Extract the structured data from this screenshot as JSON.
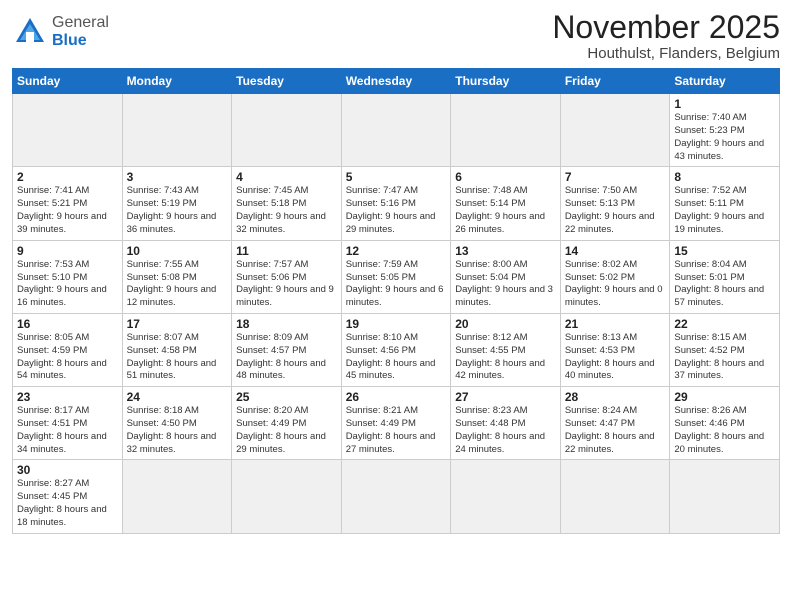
{
  "header": {
    "logo_general": "General",
    "logo_blue": "Blue",
    "month_year": "November 2025",
    "location": "Houthulst, Flanders, Belgium"
  },
  "weekdays": [
    "Sunday",
    "Monday",
    "Tuesday",
    "Wednesday",
    "Thursday",
    "Friday",
    "Saturday"
  ],
  "weeks": [
    [
      {
        "day": "",
        "info": ""
      },
      {
        "day": "",
        "info": ""
      },
      {
        "day": "",
        "info": ""
      },
      {
        "day": "",
        "info": ""
      },
      {
        "day": "",
        "info": ""
      },
      {
        "day": "",
        "info": ""
      },
      {
        "day": "1",
        "info": "Sunrise: 7:40 AM\nSunset: 5:23 PM\nDaylight: 9 hours\nand 43 minutes."
      }
    ],
    [
      {
        "day": "2",
        "info": "Sunrise: 7:41 AM\nSunset: 5:21 PM\nDaylight: 9 hours\nand 39 minutes."
      },
      {
        "day": "3",
        "info": "Sunrise: 7:43 AM\nSunset: 5:19 PM\nDaylight: 9 hours\nand 36 minutes."
      },
      {
        "day": "4",
        "info": "Sunrise: 7:45 AM\nSunset: 5:18 PM\nDaylight: 9 hours\nand 32 minutes."
      },
      {
        "day": "5",
        "info": "Sunrise: 7:47 AM\nSunset: 5:16 PM\nDaylight: 9 hours\nand 29 minutes."
      },
      {
        "day": "6",
        "info": "Sunrise: 7:48 AM\nSunset: 5:14 PM\nDaylight: 9 hours\nand 26 minutes."
      },
      {
        "day": "7",
        "info": "Sunrise: 7:50 AM\nSunset: 5:13 PM\nDaylight: 9 hours\nand 22 minutes."
      },
      {
        "day": "8",
        "info": "Sunrise: 7:52 AM\nSunset: 5:11 PM\nDaylight: 9 hours\nand 19 minutes."
      }
    ],
    [
      {
        "day": "9",
        "info": "Sunrise: 7:53 AM\nSunset: 5:10 PM\nDaylight: 9 hours\nand 16 minutes."
      },
      {
        "day": "10",
        "info": "Sunrise: 7:55 AM\nSunset: 5:08 PM\nDaylight: 9 hours\nand 12 minutes."
      },
      {
        "day": "11",
        "info": "Sunrise: 7:57 AM\nSunset: 5:06 PM\nDaylight: 9 hours\nand 9 minutes."
      },
      {
        "day": "12",
        "info": "Sunrise: 7:59 AM\nSunset: 5:05 PM\nDaylight: 9 hours\nand 6 minutes."
      },
      {
        "day": "13",
        "info": "Sunrise: 8:00 AM\nSunset: 5:04 PM\nDaylight: 9 hours\nand 3 minutes."
      },
      {
        "day": "14",
        "info": "Sunrise: 8:02 AM\nSunset: 5:02 PM\nDaylight: 9 hours\nand 0 minutes."
      },
      {
        "day": "15",
        "info": "Sunrise: 8:04 AM\nSunset: 5:01 PM\nDaylight: 8 hours\nand 57 minutes."
      }
    ],
    [
      {
        "day": "16",
        "info": "Sunrise: 8:05 AM\nSunset: 4:59 PM\nDaylight: 8 hours\nand 54 minutes."
      },
      {
        "day": "17",
        "info": "Sunrise: 8:07 AM\nSunset: 4:58 PM\nDaylight: 8 hours\nand 51 minutes."
      },
      {
        "day": "18",
        "info": "Sunrise: 8:09 AM\nSunset: 4:57 PM\nDaylight: 8 hours\nand 48 minutes."
      },
      {
        "day": "19",
        "info": "Sunrise: 8:10 AM\nSunset: 4:56 PM\nDaylight: 8 hours\nand 45 minutes."
      },
      {
        "day": "20",
        "info": "Sunrise: 8:12 AM\nSunset: 4:55 PM\nDaylight: 8 hours\nand 42 minutes."
      },
      {
        "day": "21",
        "info": "Sunrise: 8:13 AM\nSunset: 4:53 PM\nDaylight: 8 hours\nand 40 minutes."
      },
      {
        "day": "22",
        "info": "Sunrise: 8:15 AM\nSunset: 4:52 PM\nDaylight: 8 hours\nand 37 minutes."
      }
    ],
    [
      {
        "day": "23",
        "info": "Sunrise: 8:17 AM\nSunset: 4:51 PM\nDaylight: 8 hours\nand 34 minutes."
      },
      {
        "day": "24",
        "info": "Sunrise: 8:18 AM\nSunset: 4:50 PM\nDaylight: 8 hours\nand 32 minutes."
      },
      {
        "day": "25",
        "info": "Sunrise: 8:20 AM\nSunset: 4:49 PM\nDaylight: 8 hours\nand 29 minutes."
      },
      {
        "day": "26",
        "info": "Sunrise: 8:21 AM\nSunset: 4:49 PM\nDaylight: 8 hours\nand 27 minutes."
      },
      {
        "day": "27",
        "info": "Sunrise: 8:23 AM\nSunset: 4:48 PM\nDaylight: 8 hours\nand 24 minutes."
      },
      {
        "day": "28",
        "info": "Sunrise: 8:24 AM\nSunset: 4:47 PM\nDaylight: 8 hours\nand 22 minutes."
      },
      {
        "day": "29",
        "info": "Sunrise: 8:26 AM\nSunset: 4:46 PM\nDaylight: 8 hours\nand 20 minutes."
      }
    ],
    [
      {
        "day": "30",
        "info": "Sunrise: 8:27 AM\nSunset: 4:45 PM\nDaylight: 8 hours\nand 18 minutes."
      },
      {
        "day": "",
        "info": ""
      },
      {
        "day": "",
        "info": ""
      },
      {
        "day": "",
        "info": ""
      },
      {
        "day": "",
        "info": ""
      },
      {
        "day": "",
        "info": ""
      },
      {
        "day": "",
        "info": ""
      }
    ]
  ]
}
